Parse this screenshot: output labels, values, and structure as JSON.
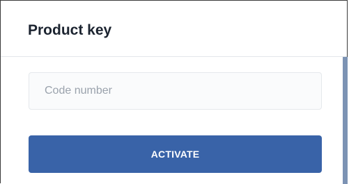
{
  "dialog": {
    "title": "Product key"
  },
  "form": {
    "code_input": {
      "value": "",
      "placeholder": "Code number"
    },
    "activate_label": "ACTIVATE"
  },
  "colors": {
    "accent": "#3963a8",
    "title_text": "#1c2430",
    "placeholder_text": "#9aa2ac",
    "scrollbar": "#7c93b4"
  }
}
